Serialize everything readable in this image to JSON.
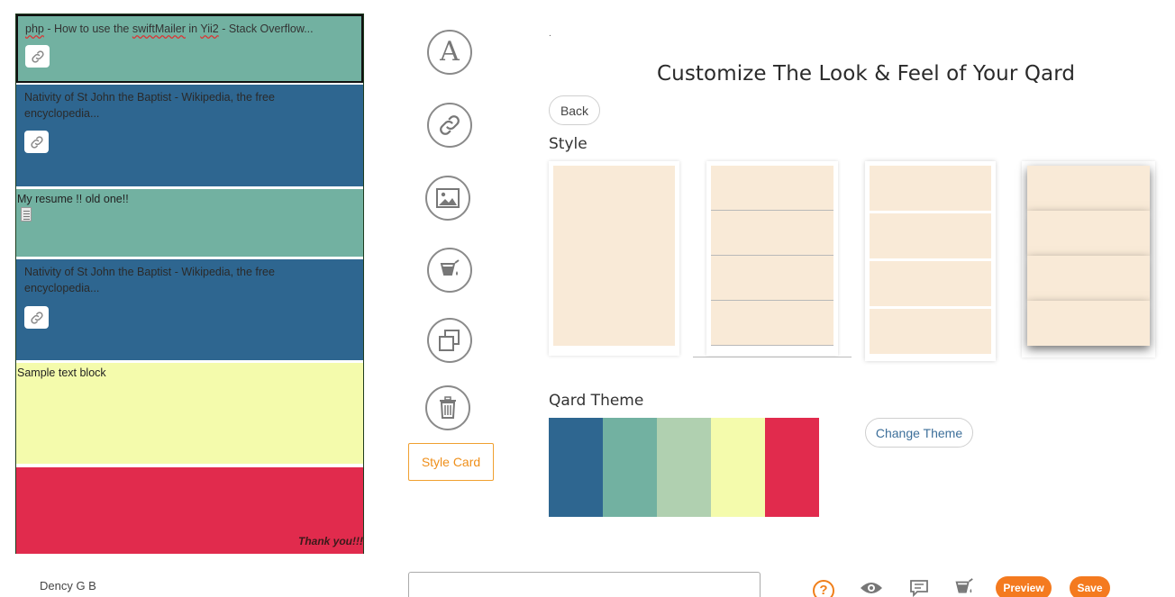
{
  "card": {
    "blocks": [
      {
        "text_prefix": "php",
        "text_mid": " - How to use the ",
        "text_u1": "swiftMailer",
        "text_mid2": " in ",
        "text_u2": "Yii2",
        "text_suffix": " - Stack Overflow...",
        "icon": "link-icon"
      },
      {
        "text": "Nativity of St John the Baptist - Wikipedia, the free encyclopedia...",
        "icon": "link-icon"
      },
      {
        "text": "My resume !! old one!!",
        "icon": "document-icon"
      },
      {
        "text": "Nativity of St John the Baptist - Wikipedia, the free encyclopedia...",
        "icon": "link-icon"
      },
      {
        "text": "Sample text block"
      },
      {
        "text": "Thank you!!!"
      }
    ],
    "block_colors": [
      "#72b1a1",
      "#2e6690",
      "#72b1a1",
      "#2e6690",
      "#f4fbac",
      "#e12b4d"
    ]
  },
  "user": {
    "name": "Dency G B"
  },
  "tools": {
    "text_tool_glyph": "A",
    "icons": [
      "text-icon",
      "link-icon",
      "image-icon",
      "paint-bucket-icon",
      "copy-icon",
      "trash-icon"
    ],
    "style_card_label": "Style Card"
  },
  "panel": {
    "dot": ".",
    "title": "Customize The Look & Feel of Your Qard",
    "back_label": "Back",
    "style_label": "Style",
    "style_options": [
      "single-block",
      "lined-stack",
      "spaced-stack",
      "shadow-stack"
    ],
    "theme_label": "Qard Theme",
    "theme_colors": [
      "#2e6690",
      "#72b1a1",
      "#b0d0b0",
      "#f4fbac",
      "#e12b4d"
    ],
    "change_theme_label": "Change Theme"
  },
  "bottom": {
    "help_glyph": "?",
    "icons": [
      "help-icon",
      "eye-icon",
      "comment-icon",
      "paint-bucket-icon"
    ],
    "preview_label": "Preview",
    "save_label": "Save"
  }
}
